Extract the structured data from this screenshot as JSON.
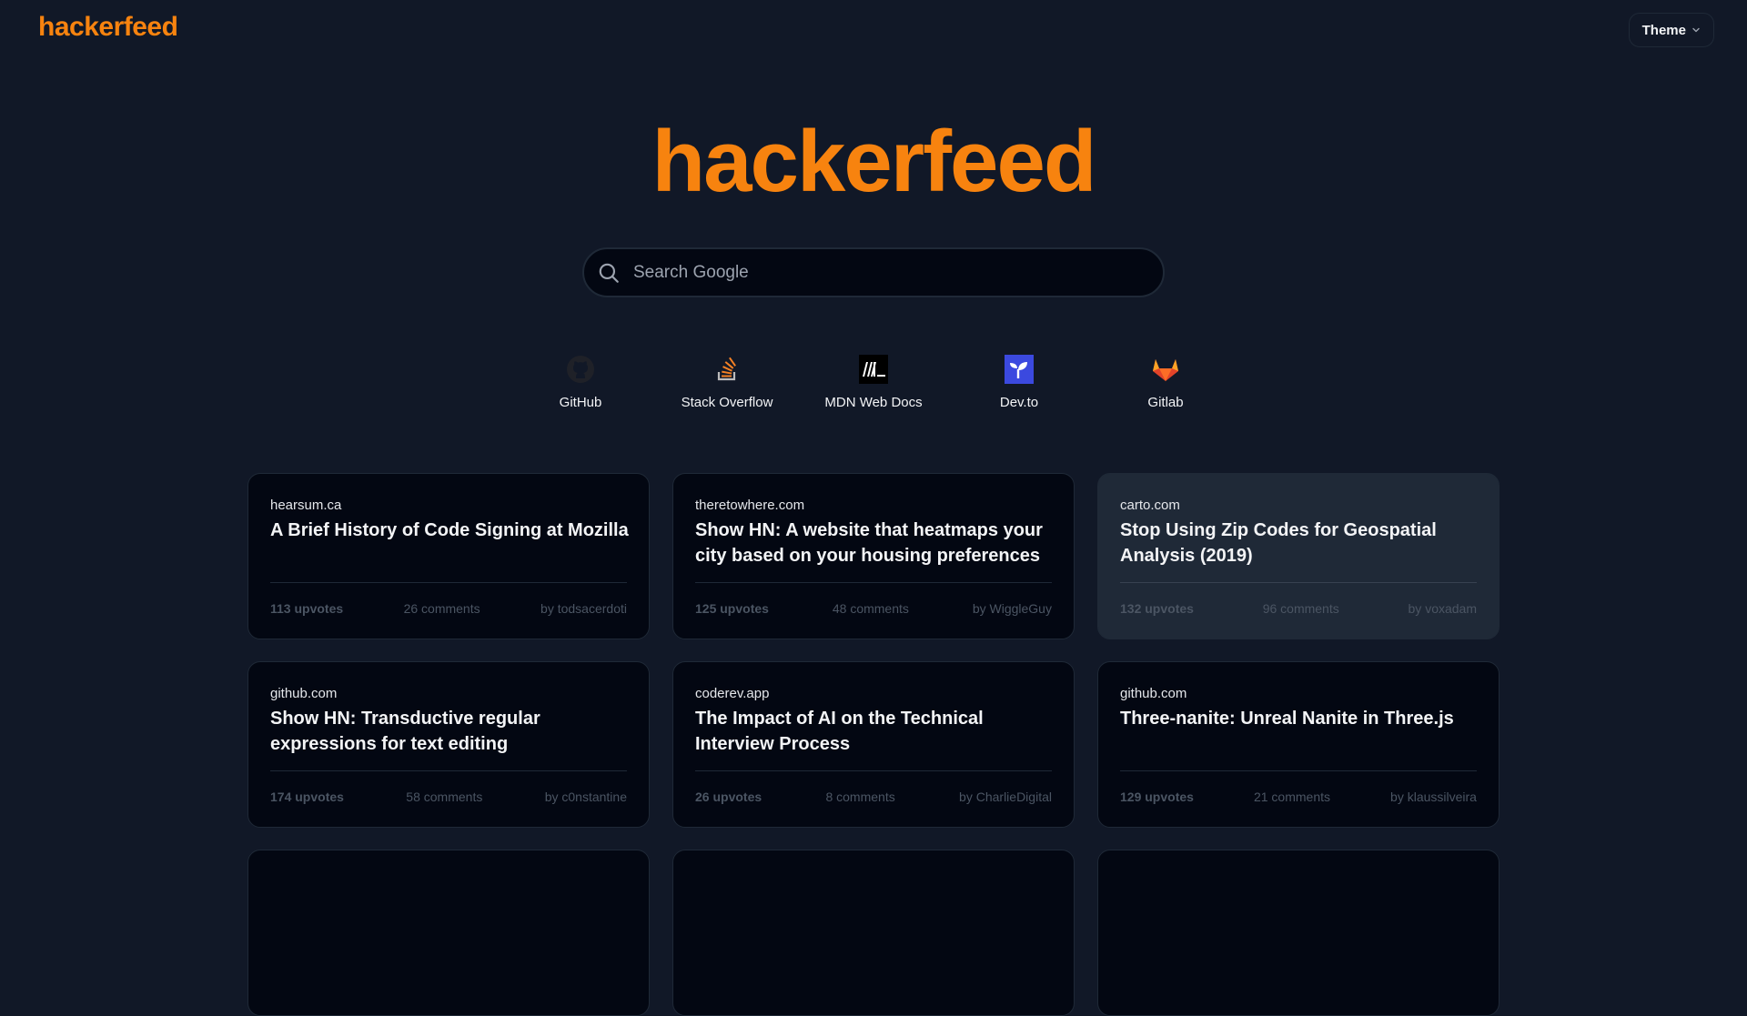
{
  "navbar": {
    "brand": "hackerfeed",
    "theme_label": "Theme"
  },
  "hero": {
    "title": "hackerfeed"
  },
  "search": {
    "placeholder": "Search Google"
  },
  "shortcuts": [
    {
      "label": "GitHub",
      "icon": "github-icon"
    },
    {
      "label": "Stack Overflow",
      "icon": "stackoverflow-icon"
    },
    {
      "label": "MDN Web Docs",
      "icon": "mdn-icon"
    },
    {
      "label": "Dev.to",
      "icon": "devto-icon"
    },
    {
      "label": "Gitlab",
      "icon": "gitlab-icon"
    }
  ],
  "colors": {
    "accent": "#f7830f",
    "background": "#111827",
    "card": "#030712",
    "card_hover": "#1f2937"
  },
  "cards": [
    {
      "domain": "hearsum.ca",
      "title": "A Brief History of Code Signing at Mozilla",
      "upvotes": "113 upvotes",
      "comments": "26 comments",
      "author": "by todsacerdoti"
    },
    {
      "domain": "theretowhere.com",
      "title": "Show HN: A website that heatmaps your city based on your housing preferences",
      "upvotes": "125 upvotes",
      "comments": "48 comments",
      "author": "by WiggleGuy"
    },
    {
      "domain": "carto.com",
      "title": "Stop Using Zip Codes for Geospatial Analysis (2019)",
      "upvotes": "132 upvotes",
      "comments": "96 comments",
      "author": "by voxadam"
    },
    {
      "domain": "github.com",
      "title": "Show HN: Transductive regular expressions for text editing",
      "upvotes": "174 upvotes",
      "comments": "58 comments",
      "author": "by c0nstantine"
    },
    {
      "domain": "coderev.app",
      "title": "The Impact of AI on the Technical Interview Process",
      "upvotes": "26 upvotes",
      "comments": "8 comments",
      "author": "by CharlieDigital"
    },
    {
      "domain": "github.com",
      "title": "Three-nanite: Unreal Nanite in Three.js",
      "upvotes": "129 upvotes",
      "comments": "21 comments",
      "author": "by klaussilveira"
    }
  ]
}
